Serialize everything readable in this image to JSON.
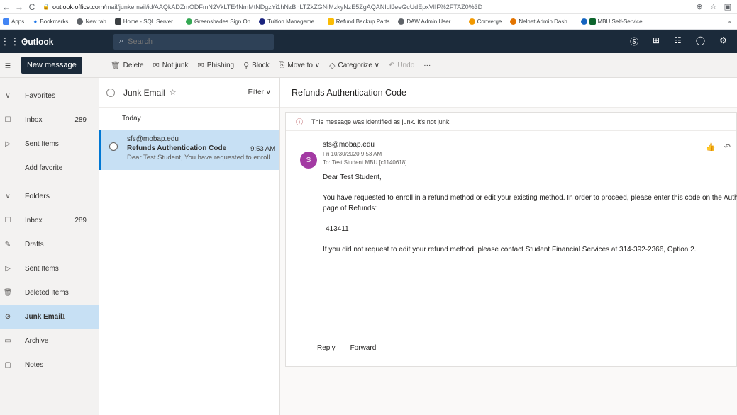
{
  "browser": {
    "url_domain": "outlook.office.com",
    "url_path": "/mail/junkemail/id/AAQkADZmODFmN2VkLTE4NmMtNDgzYi1hNzBhLTZkZGNiMzkyNzE5ZgAQANIdlJeeGcUdEpxVlIF%2FTAZ0%3D",
    "bookmarks": [
      "Apps",
      "Bookmarks",
      "New tab",
      "Home - SQL Server...",
      "Greenshades Sign On",
      "Tuition Manageme...",
      "Refund Backup Parts",
      "DAW Admin User L...",
      "Converge",
      "Nelnet Admin Dash...",
      "MBU Self-Service"
    ],
    "more": "»"
  },
  "header": {
    "app_name": "Outlook",
    "search_placeholder": "Search"
  },
  "command": {
    "new_message": "New message",
    "toolbar": [
      "Delete",
      "Not junk",
      "Phishing",
      "Block",
      "Move to ∨",
      "Categorize ∨",
      "Undo",
      "···"
    ]
  },
  "nav": {
    "favorites": "Favorites",
    "fav_items": [
      {
        "label": "Inbox",
        "count": "289"
      },
      {
        "label": "Sent Items",
        "count": ""
      },
      {
        "label": "Add favorite",
        "count": ""
      }
    ],
    "folders": "Folders",
    "folder_items": [
      {
        "label": "Inbox",
        "count": "289"
      },
      {
        "label": "Drafts",
        "count": ""
      },
      {
        "label": "Sent Items",
        "count": ""
      },
      {
        "label": "Deleted Items",
        "count": ""
      },
      {
        "label": "Junk Email",
        "count": "1"
      },
      {
        "label": "Archive",
        "count": ""
      },
      {
        "label": "Notes",
        "count": ""
      }
    ]
  },
  "list": {
    "folder_name": "Junk Email",
    "filter": "Filter ∨",
    "group": "Today",
    "message": {
      "from": "sfs@mobap.edu",
      "subject": "Refunds Authentication Code",
      "time": "9:53 AM",
      "preview": "Dear Test Student, You have requested to enroll ..."
    }
  },
  "reading": {
    "subject": "Refunds Authentication Code",
    "junk_notice": "This message was identified as junk. It's not junk",
    "avatar_letter": "S",
    "sender": "sfs@mobap.edu",
    "date": "Fri 10/30/2020 9:53 AM",
    "to": "To: Test Student MBU [c1140618]",
    "body": {
      "greeting": "Dear Test Student,",
      "para1_a": "You have requested to enroll in a refund method or edit your existing method.  In order to proceed, please enter this code on the Authe",
      "para1_b": "page of Refunds:",
      "code": "413411",
      "para2": "If you did not request to edit your refund method, please contact Student Financial Services at 314-392-2366, Option 2."
    },
    "reply": "Reply",
    "forward": "Forward"
  },
  "colors": {
    "header_bg": "#1b2a3a",
    "selection": "#c7e0f4",
    "avatar": "#a33aa3"
  }
}
